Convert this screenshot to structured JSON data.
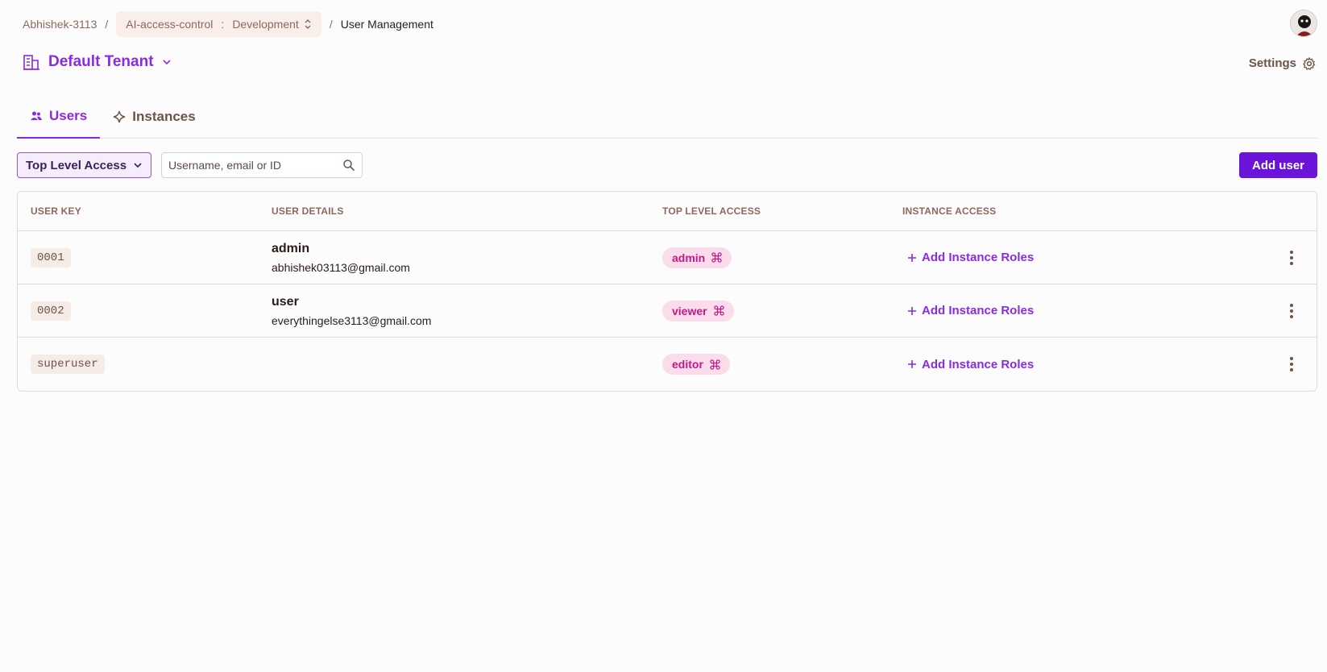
{
  "breadcrumb": {
    "org": "Abhishek-3113",
    "project": "AI-access-control",
    "env": "Development",
    "current": "User Management"
  },
  "tenant": {
    "title": "Default Tenant"
  },
  "settings": {
    "label": "Settings"
  },
  "tabs": [
    {
      "label": "Users",
      "active": true
    },
    {
      "label": "Instances",
      "active": false
    }
  ],
  "toolbar": {
    "filter_label": "Top Level Access",
    "search_placeholder": "Username, email or ID",
    "add_user_label": "Add user"
  },
  "table": {
    "headers": [
      "USER KEY",
      "USER DETAILS",
      "TOP LEVEL ACCESS",
      "INSTANCE ACCESS"
    ],
    "rows": [
      {
        "key": "0001",
        "name": "admin",
        "email": "abhishek03113@gmail.com",
        "role": "admin",
        "instance_action": "Add Instance Roles"
      },
      {
        "key": "0002",
        "name": "user",
        "email": "everythingelse3113@gmail.com",
        "role": "viewer",
        "instance_action": "Add Instance Roles"
      },
      {
        "key": "superuser",
        "name": "",
        "email": "",
        "role": "editor",
        "instance_action": "Add Instance Roles"
      }
    ]
  },
  "colors": {
    "accent": "#8a2be2",
    "primary_button": "#6c13d9",
    "role_chip_bg": "#fbdcea",
    "role_chip_text": "#c2198a"
  }
}
